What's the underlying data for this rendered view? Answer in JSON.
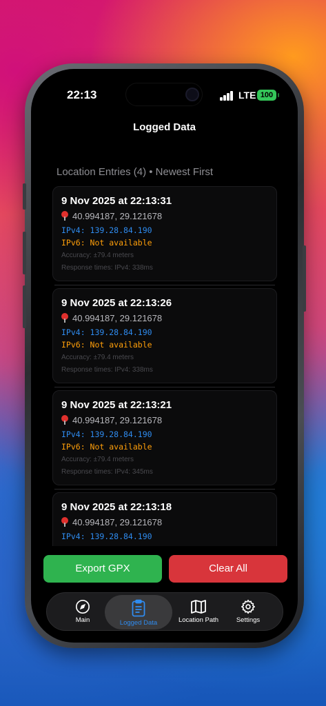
{
  "status_bar": {
    "time": "22:13",
    "network": "LTE",
    "battery": "100"
  },
  "nav": {
    "title": "Logged Data"
  },
  "section_header": "Location Entries (4) • Newest First",
  "entries": [
    {
      "timestamp": "9 Nov 2025 at 22:13:31",
      "coords": "40.994187, 29.121678",
      "ipv4": "IPv4: 139.28.84.190",
      "ipv6": "IPv6: Not available",
      "accuracy": "Accuracy: ±79.4 meters",
      "response": "Response times: IPv4: 338ms"
    },
    {
      "timestamp": "9 Nov 2025 at 22:13:26",
      "coords": "40.994187, 29.121678",
      "ipv4": "IPv4: 139.28.84.190",
      "ipv6": "IPv6: Not available",
      "accuracy": "Accuracy: ±79.4 meters",
      "response": "Response times: IPv4: 338ms"
    },
    {
      "timestamp": "9 Nov 2025 at 22:13:21",
      "coords": "40.994187, 29.121678",
      "ipv4": "IPv4: 139.28.84.190",
      "ipv6": "IPv6: Not available",
      "accuracy": "Accuracy: ±79.4 meters",
      "response": "Response times: IPv4: 345ms"
    },
    {
      "timestamp": "9 Nov 2025 at 22:13:18",
      "coords": "40.994187, 29.121678",
      "ipv4": "IPv4: 139.28.84.190"
    }
  ],
  "actions": {
    "export_label": "Export GPX",
    "clear_label": "Clear All"
  },
  "tabs": [
    {
      "label": "Main",
      "icon": "navigation-arrow-icon"
    },
    {
      "label": "Logged Data",
      "icon": "clipboard-icon",
      "active": true
    },
    {
      "label": "Location Path",
      "icon": "map-icon"
    },
    {
      "label": "Settings",
      "icon": "gear-icon"
    }
  ],
  "colors": {
    "accent_blue": "#2f8cf0",
    "ipv6_orange": "#ff9f0a",
    "export_green": "#2fb34f",
    "clear_red": "#d8353b",
    "battery_green": "#34c759"
  }
}
